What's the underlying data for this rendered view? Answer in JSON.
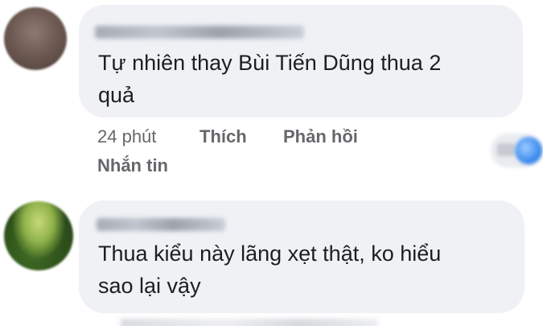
{
  "comments": [
    {
      "author_name": "",
      "text": "Tự nhiên thay Bùi Tiến Dũng thua 2\nquả",
      "time": "24 phút",
      "like_label": "Thích",
      "reply_label": "Phản hồi",
      "message_label": "Nhắn tin"
    },
    {
      "author_name": "",
      "text": "Thua kiểu này lãng xẹt thật, ko hiểu\nsao lại vậy"
    }
  ],
  "colors": {
    "bubble": "#eff1f5",
    "text": "#1c1e21",
    "meta": "#65676b",
    "reaction_accent": "#3b8bef"
  },
  "icons": {
    "reaction": "like-reaction-icon"
  }
}
